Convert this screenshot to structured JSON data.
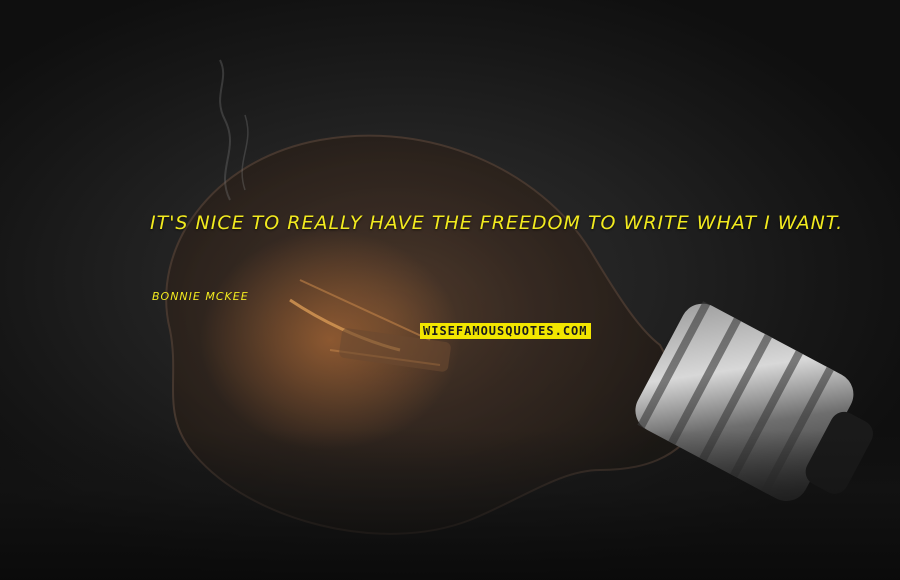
{
  "quote": {
    "text": "It's nice to really have the freedom to write what I want.",
    "author": "Bonnie McKee"
  },
  "watermark": {
    "text": "WISEFAMOUSQUOTES.COM"
  },
  "colors": {
    "quote_text": "#f2ea1f",
    "watermark_bg": "#f2e600",
    "background": "#1d1d1d"
  },
  "background_image": {
    "subject": "light-bulb-icon"
  }
}
